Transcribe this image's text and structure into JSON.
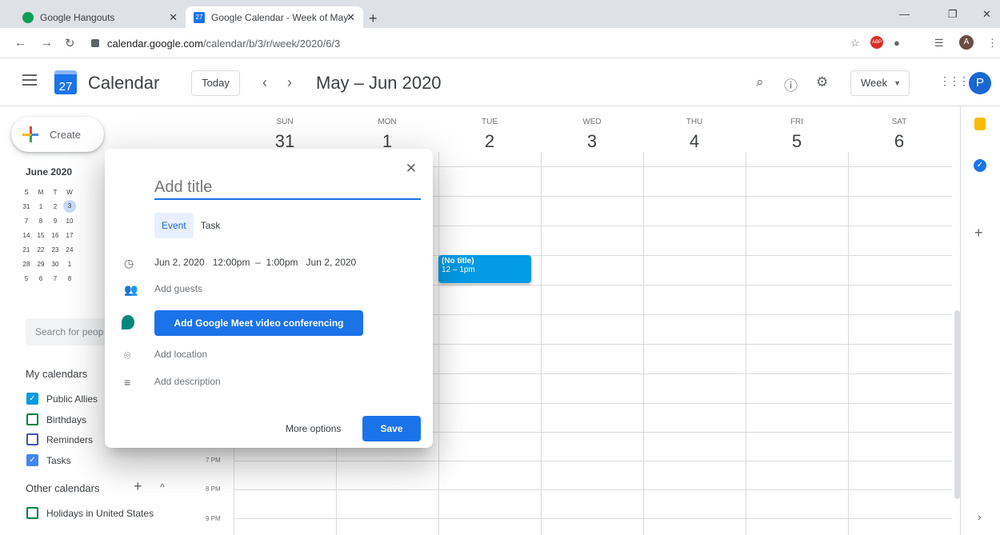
{
  "browser": {
    "tabs": [
      {
        "title": "Google Hangouts"
      },
      {
        "title": "Google Calendar - Week of May"
      }
    ],
    "new_tab": "+",
    "url_host": "calendar.google.com",
    "url_path": "/calendar/b/3/r/week/2020/6/3",
    "profile_initial": "A"
  },
  "header": {
    "app_icon_day": "27",
    "app_title": "Calendar",
    "today_label": "Today",
    "date_range": "May – Jun 2020",
    "view_label": "Week",
    "avatar_initial": "P"
  },
  "sidebar": {
    "create_label": "Create",
    "mini_month": "June 2020",
    "weekday_initials": [
      "S",
      "M",
      "T",
      "W"
    ],
    "mini_rows": [
      [
        "31",
        "1",
        "2",
        "3"
      ],
      [
        "7",
        "8",
        "9",
        "10"
      ],
      [
        "14",
        "15",
        "16",
        "17"
      ],
      [
        "21",
        "22",
        "23",
        "24"
      ],
      [
        "28",
        "29",
        "30",
        "1"
      ],
      [
        "5",
        "6",
        "7",
        "8"
      ]
    ],
    "search_placeholder": "Search for peop",
    "my_calendars_title": "My calendars",
    "my_calendars": [
      {
        "label": "Public Allies",
        "checked": true,
        "color": "#039be5"
      },
      {
        "label": "Birthdays",
        "checked": false,
        "color": "#0b8043"
      },
      {
        "label": "Reminders",
        "checked": false,
        "color": "#3f51b5"
      },
      {
        "label": "Tasks",
        "checked": true,
        "color": "#4285f4"
      }
    ],
    "other_calendars_title": "Other calendars",
    "other_calendars": [
      {
        "label": "Holidays in United States",
        "checked": false,
        "color": "#0b8043"
      }
    ]
  },
  "week": {
    "days": [
      {
        "name": "SUN",
        "date": "31"
      },
      {
        "name": "MON",
        "date": "1"
      },
      {
        "name": "TUE",
        "date": "2"
      },
      {
        "name": "WED",
        "date": "3"
      },
      {
        "name": "THU",
        "date": "4"
      },
      {
        "name": "FRI",
        "date": "5"
      },
      {
        "name": "SAT",
        "date": "6"
      }
    ],
    "time_labels": [
      "7 PM",
      "8 PM",
      "9 PM"
    ],
    "event": {
      "title": "(No title)",
      "time": "12 – 1pm"
    }
  },
  "dialog": {
    "title_placeholder": "Add title",
    "tab_event": "Event",
    "tab_task": "Task",
    "start_date": "Jun 2, 2020",
    "start_time": "12:00pm",
    "dash": "–",
    "end_time": "1:00pm",
    "end_date": "Jun 2, 2020",
    "add_guests": "Add guests",
    "meet_button": "Add Google Meet video conferencing",
    "add_location": "Add location",
    "add_description": "Add description",
    "more_options": "More options",
    "save": "Save"
  }
}
